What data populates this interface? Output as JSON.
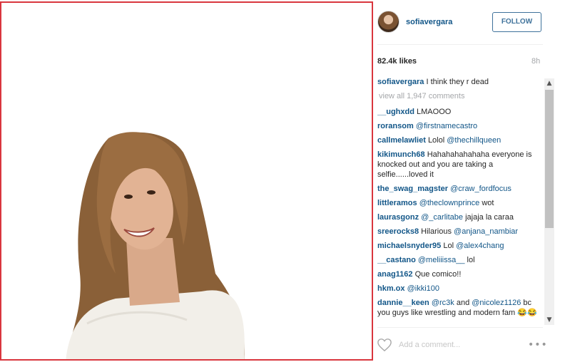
{
  "post": {
    "username": "sofiavergara",
    "follow_label": "FOLLOW",
    "likes": "82.4k likes",
    "time": "8h",
    "caption_user": "sofiavergara",
    "caption_text": "I think they r dead",
    "view_all": "view all 1,947 comments"
  },
  "comments": [
    {
      "user": "__ughxdd",
      "text": "LMAOOO",
      "mention": ""
    },
    {
      "user": "roransom",
      "text": "",
      "mention": "@firstnamecastro"
    },
    {
      "user": "callmelawliet",
      "text": "Lolol",
      "mention": "@thechillqueen"
    },
    {
      "user": "kikimunch68",
      "text": "Hahahahahahaha everyone is knocked out and you are taking a selfie......loved it",
      "mention": ""
    },
    {
      "user": "the_swag_magster",
      "text": "",
      "mention": "@craw_fordfocus"
    },
    {
      "user": "littleramos",
      "text": "",
      "mention": "@theclownprince",
      "after": "wot"
    },
    {
      "user": "laurasgonz",
      "text": "",
      "mention": "@_carlitabe",
      "after": "jajaja la caraa"
    },
    {
      "user": "sreerocks8",
      "text": "Hilarious",
      "mention": "@anjana_nambiar"
    },
    {
      "user": "michaelsnyder95",
      "text": "Lol",
      "mention": "@alex4chang"
    },
    {
      "user": "__castano",
      "text": "",
      "mention": "@meliiissa__",
      "after": "lol"
    },
    {
      "user": "anag1162",
      "text": "Que comico!!",
      "mention": ""
    },
    {
      "user": "hkm.ox",
      "text": "",
      "mention": "@ikki100"
    },
    {
      "user": "dannie__keen",
      "text": "",
      "mention": "@rc3k",
      "after": "and",
      "mention2": "@nicolez1126",
      "after2": "bc you guys like wrestling and modern fam 😂😂"
    }
  ],
  "footer": {
    "comment_placeholder": "Add a comment...",
    "more_label": "•••"
  },
  "icons": {
    "heart": "heart-icon",
    "scroll_up": "▲",
    "scroll_down": "▼"
  },
  "colors": {
    "accent": "#125688",
    "follow": "#3f729b",
    "frame_border": "#d9363e"
  }
}
